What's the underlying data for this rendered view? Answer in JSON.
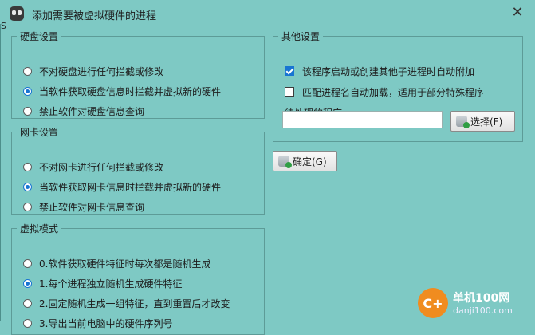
{
  "window": {
    "title": "添加需要被虚拟硬件的进程",
    "close_glyph": "✕",
    "edge_text": "S"
  },
  "disk": {
    "legend": "硬盘设置",
    "options": [
      "不对硬盘进行任何拦截或修改",
      "当软件获取硬盘信息时拦截并虚拟新的硬件",
      "禁止软件对硬盘信息查询"
    ],
    "selected_index": 1
  },
  "nic": {
    "legend": "网卡设置",
    "options": [
      "不对网卡进行任何拦截或修改",
      "当软件获取网卡信息时拦截并虚拟新的硬件",
      "禁止软件对网卡信息查询"
    ],
    "selected_index": 1
  },
  "mode": {
    "legend": "虚拟模式",
    "options": [
      "0.软件获取硬件特征时每次都是随机生成",
      "1.每个进程独立随机生成硬件特征",
      "2.固定随机生成一组特征，直到重置后才改变",
      "3.导出当前电脑中的硬件序列号"
    ],
    "selected_index": 1
  },
  "other": {
    "legend": "其他设置",
    "auto_attach": {
      "label": "该程序启动或创建其他子进程时自动附加",
      "checked": true
    },
    "auto_match": {
      "label": "匹配进程名自动加载，适用于部分特殊程序",
      "checked": false
    },
    "pending_label": "待处理的程序:",
    "pending_value": "",
    "select_button": "选择(F)"
  },
  "ok_button": "确定(G)",
  "watermark": {
    "logo_text": "C+",
    "name": "单机100网",
    "url": "danji100.com"
  },
  "colors": {
    "background": "#7ec9c4",
    "accent": "#1874d2",
    "watermark": "#f08c1f"
  }
}
